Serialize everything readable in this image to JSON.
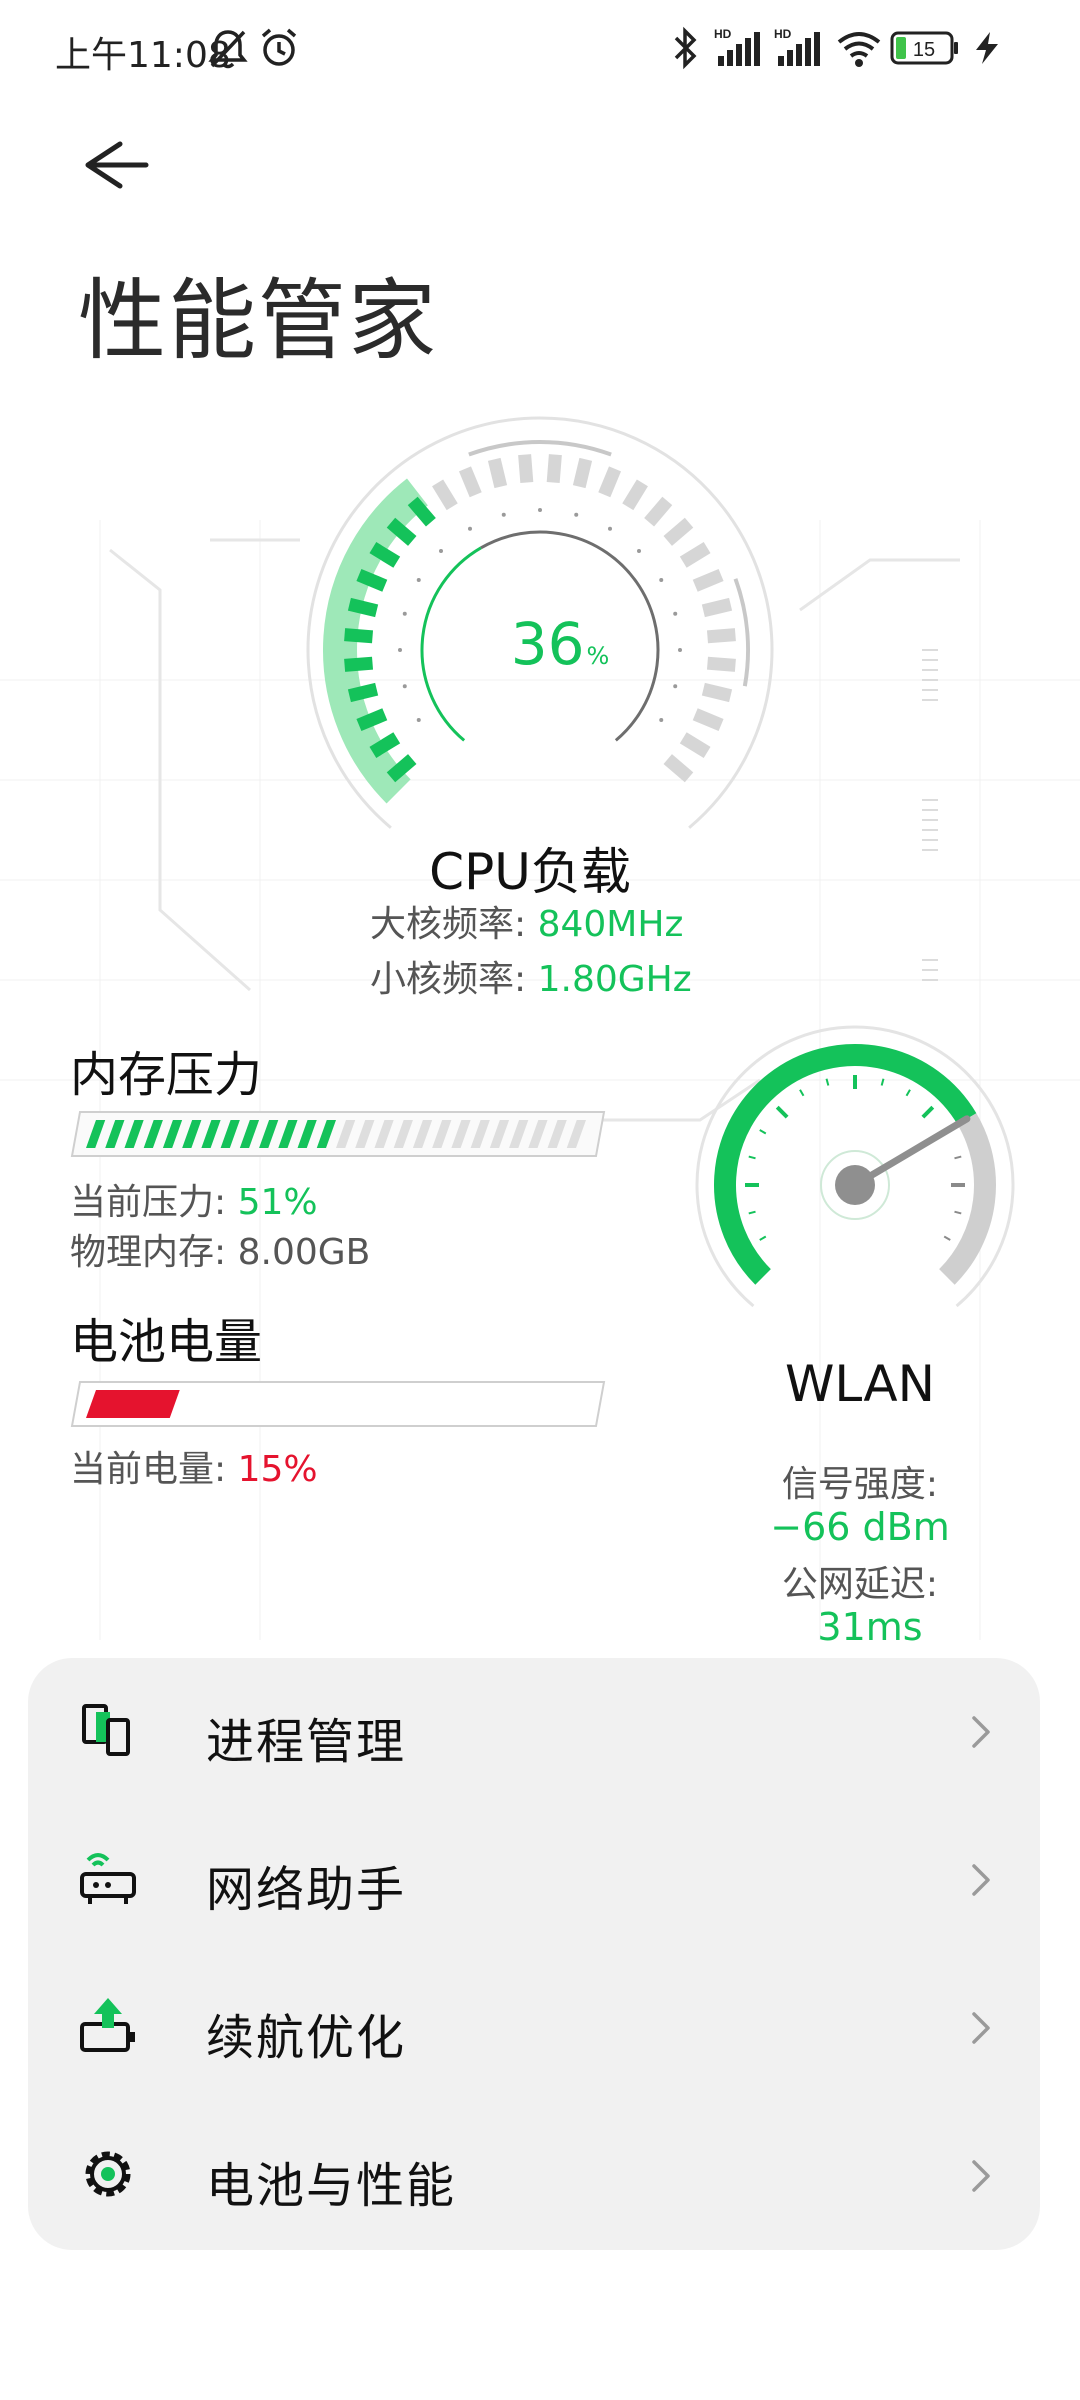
{
  "status_bar": {
    "time": "上午11:08",
    "icons": [
      "mute-bell-icon",
      "alarm-icon",
      "bluetooth-icon",
      "signal-hd-1-icon",
      "signal-hd-2-icon",
      "wifi-icon",
      "battery-icon",
      "charging-icon"
    ],
    "battery_level_text": "15"
  },
  "header": {
    "back_icon": "arrow-left-icon",
    "title": "性能管家"
  },
  "cpu": {
    "load_value": "36",
    "load_unit": "%",
    "load_fraction": 0.36,
    "title": "CPU负载",
    "big_core_label": "大核频率:",
    "big_core_value": "840MHz",
    "small_core_label": "小核频率:",
    "small_core_value": "1.80GHz"
  },
  "memory": {
    "title": "内存压力",
    "pressure_fraction": 0.51,
    "current_label": "当前压力:",
    "current_value": "51%",
    "physical_label": "物理内存:",
    "physical_value": "8.00GB"
  },
  "battery": {
    "title": "电池电量",
    "level_fraction": 0.15,
    "current_label": "当前电量:",
    "current_value": "15%"
  },
  "wlan": {
    "title": "WLAN",
    "signal_label": "信号强度:",
    "signal_value": "−66 dBm",
    "latency_label": "公网延迟:",
    "latency_value": "31ms",
    "signal_fraction": 0.72
  },
  "menu": {
    "items": [
      {
        "label": "进程管理",
        "icon": "process-manage-icon"
      },
      {
        "label": "网络助手",
        "icon": "network-assistant-icon"
      },
      {
        "label": "续航优化",
        "icon": "battery-optimize-icon"
      },
      {
        "label": "电池与性能",
        "icon": "gear-icon"
      }
    ]
  },
  "colors": {
    "accent_green": "#14c25a",
    "battery_red": "#e5132e",
    "card_bg": "#f1f1f1"
  }
}
